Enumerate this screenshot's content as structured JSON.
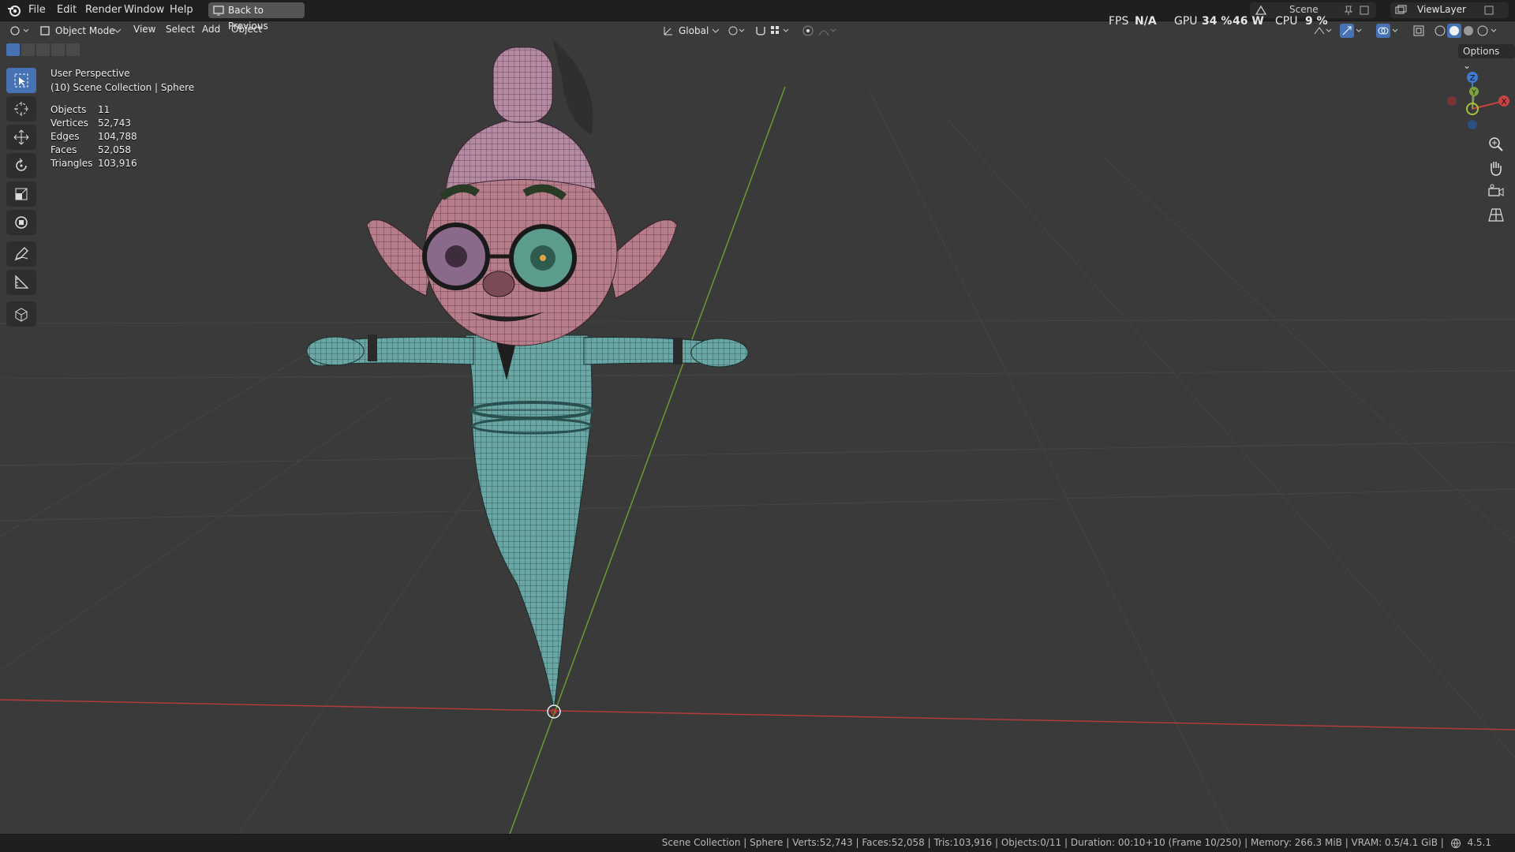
{
  "menu": {
    "file": "File",
    "edit": "Edit",
    "render": "Render",
    "window": "Window",
    "help": "Help",
    "back_to_previous": "Back to Previous"
  },
  "performance": {
    "fps_label": "FPS",
    "fps_value": "N/A",
    "gpu_label": "GPU",
    "gpu_percent": "34 %",
    "gpu_watts": "46 W",
    "cpu_label": "CPU",
    "cpu_percent": "9 %"
  },
  "scene": {
    "name": "Scene"
  },
  "view_layer": {
    "name": "ViewLayer"
  },
  "header": {
    "mode": "Object Mode",
    "view": "View",
    "select": "Select",
    "add": "Add",
    "object": "Object",
    "orientation": "Global",
    "options": "Options"
  },
  "overlay": {
    "perspective": "User Perspective",
    "collection": "(10) Scene Collection | Sphere",
    "stats": [
      {
        "label": "Objects",
        "value": "11"
      },
      {
        "label": "Vertices",
        "value": "52,743"
      },
      {
        "label": "Edges",
        "value": "104,788"
      },
      {
        "label": "Faces",
        "value": "52,058"
      },
      {
        "label": "Triangles",
        "value": "103,916"
      }
    ]
  },
  "status_bar": {
    "text": "Scene Collection | Sphere | Verts:52,743 | Faces:52,058 | Tris:103,916 | Objects:0/11 | Duration: 00:10+10 (Frame 10/250) | Memory: 266.3 MiB | VRAM: 0.5/4.1 GiB |",
    "version": "4.5.1"
  },
  "gizmo": {
    "z": "Z",
    "y": "Y",
    "x": "X"
  },
  "colors": {
    "accent": "#4772b3",
    "background": "#3a3a3a",
    "x_axis": "#c8423f",
    "y_axis": "#7ea33a",
    "z_axis": "#3d7bd4"
  }
}
